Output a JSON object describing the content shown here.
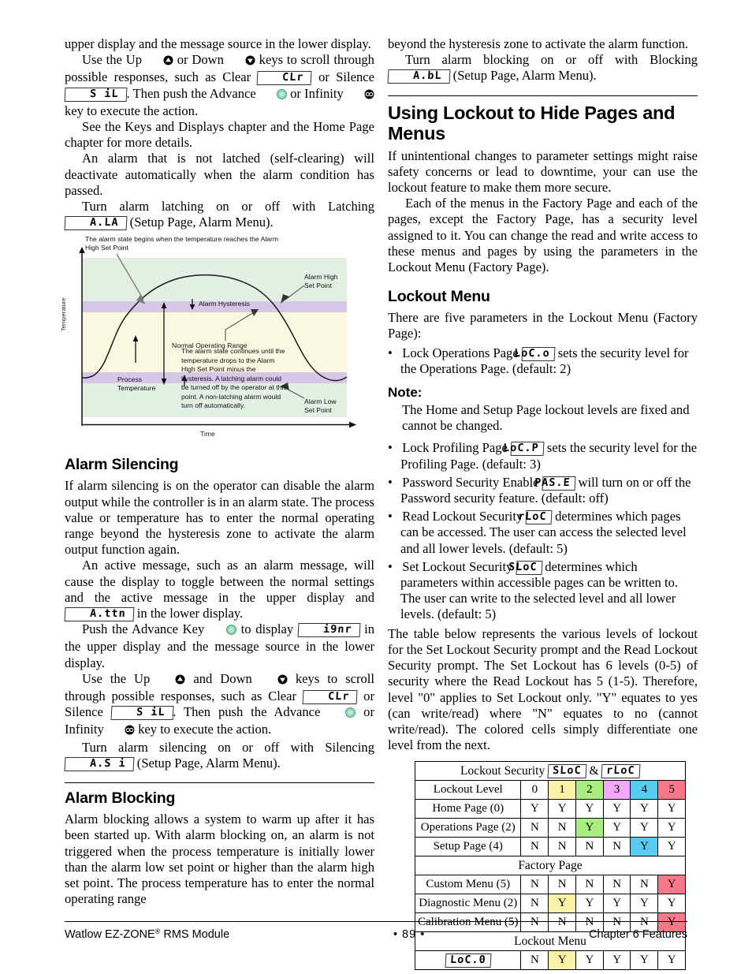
{
  "left_column": {
    "para_1": "upper display and the message source in the lower display.",
    "para_2_a": "Use the Up",
    "para_2_b": "or Down",
    "para_2_c": "keys to scroll through possible responses, such as Clear",
    "para_2_seg_clear": "CLr",
    "para_2_d": "or Silence",
    "para_2_seg_silence": "S iL",
    "para_2_e": ". Then push the Advance",
    "para_2_f": "or Infinity",
    "para_2_g": "key to execute the action.",
    "para_3": "See the Keys and Displays chapter and the Home Page chapter for more details.",
    "para_4": "An alarm that is not latched (self-clearing) will deactivate automatically when the alarm condition has passed.",
    "para_5_a": "Turn alarm latching on or off with Latching",
    "para_5_seg": "A.LA",
    "para_5_b": "(Setup Page, Alarm Menu).",
    "alarm_silencing": {
      "heading": "Alarm Silencing",
      "p1": "If alarm silencing is on the operator can disable the alarm output while the controller is in an alarm state. The process value or temperature has to enter the normal operating range beyond the hysteresis zone to activate the alarm output function again.",
      "p2_a": "An active message, such as an alarm message, will cause the display to toggle between the normal settings and the active message in the upper display and",
      "p2_seg": "A.ttn",
      "p2_b": "in the lower display.",
      "p3_a": "Push the Advance Key",
      "p3_b": "to display",
      "p3_seg": "i9nr",
      "p3_c": "in the upper display and the message source in the lower display.",
      "p4_a": "Use the Up",
      "p4_b": "and Down",
      "p4_c": "keys to scroll through possible responses, such as Clear",
      "p4_seg_clear": "CLr",
      "p4_d": "or Silence",
      "p4_seg_silence": "S iL",
      "p4_e": ". Then push the Advance",
      "p4_f": "or Infinity",
      "p4_g": "key to execute the action.",
      "p5_a": "Turn alarm silencing on or off with Silencing",
      "p5_seg": "A.S i",
      "p5_b": "(Setup Page, Alarm Menu)."
    },
    "alarm_blocking": {
      "heading": "Alarm Blocking",
      "p1": "Alarm blocking allows a system to warm up after it has been started up. With alarm blocking on, an alarm is not triggered when the process temperature is initially lower than the alarm low set point or higher than the alarm high set point. The process temperature has to enter the normal operating range"
    }
  },
  "figure": {
    "callout_top": "The alarm state begins when the temperature reaches the Alarm High Set Point",
    "label_alarm_high": "Alarm High\nSet Point",
    "label_alarm_high_l1": "Alarm High",
    "label_alarm_high_l2": "Set Point",
    "label_alarm_low_l1": "Alarm Low",
    "label_alarm_low_l2": "Set Point",
    "label_hysteresis": "Alarm Hysteresis",
    "label_normal_range": "Normal Operating Range",
    "label_process_temp_l1": "Process",
    "label_process_temp_l2": "Temperature",
    "callout_body": "The alarm state continues until the temperature drops to the Alarm High Set Point minus the hysteresis. A latching alarm could be turned off by the operator at this point. A non-latching alarm would turn off automatically.",
    "axis_y": "Temperature",
    "axis_x": "Time",
    "colors": {
      "alarm_zone": "#e2efe3",
      "hysteresis_band": "#d6c7e8",
      "normal_range": "#fbf8e2"
    }
  },
  "right_column": {
    "para_1": "beyond the hysteresis zone to activate the alarm function.",
    "para_2_a": "Turn alarm blocking on or off with Blocking",
    "para_2_seg": "A.bL",
    "para_2_b": "(Setup Page, Alarm Menu).",
    "major_heading": "Using Lockout to Hide Pages and Menus",
    "para_3": "If unintentional changes to parameter settings might raise safety concerns or lead to downtime, your can use the lockout feature to make them more secure.",
    "para_4": "Each of the menus in the Factory Page and each of the pages, except the Factory Page, has a security level assigned to it. You can change the read and write access to these menus and pages by using the parameters in the Lockout Menu (Factory Page).",
    "lockout_menu": {
      "heading": "Lockout Menu",
      "intro": "There are five parameters in the Lockout Menu (Factory Page):",
      "items": [
        {
          "pre": "Lock Operations Page",
          "seg": "LoC.o",
          "post": "sets the security level for the Operations Page. (default: 2)"
        },
        {
          "pre": "Lock Profiling Page",
          "seg": "LoC.P",
          "post": "sets the security level for the Profiling Page. (default: 3)"
        },
        {
          "pre": "Password Security Enable",
          "seg": "PAS.E",
          "post": "will turn on or off the Password security feature. (default: off)"
        },
        {
          "pre": "Read Lockout Security",
          "seg": "rLoC",
          "post": "determines which pages can be accessed. The user can access the selected level and all lower levels. (default: 5)"
        },
        {
          "pre": "Set Lockout Security",
          "seg": "SLoC",
          "post": "determines which parameters within accessible pages can be written to. The user can write to the selected level and all lower levels. (default: 5)"
        }
      ],
      "note_heading": "Note:",
      "note_body": "The Home and Setup Page lockout levels are fixed and cannot be changed."
    },
    "table_intro": "The table below represents the various levels of lockout for the Set Lockout Security prompt and the Read Lockout Security prompt. The Set Lockout has 6 levels (0-5) of security where the Read Lockout has 5 (1-5). Therefore, level \"0\" applies to Set Lockout only. \"Y\" equates to yes (can write/read) where \"N\" equates to no (cannot write/read). The colored cells simply differentiate one level from the next."
  },
  "table": {
    "title_pre": "Lockout Security",
    "title_seg_1": "SLoC",
    "title_amp": "&",
    "title_seg_2": "rLoC",
    "level_label": "Lockout Level",
    "levels": [
      "0",
      "1",
      "2",
      "3",
      "4",
      "5"
    ],
    "level_colors": [
      "#ffffff",
      "#fbf2a8",
      "#aaee80",
      "#f0a8f8",
      "#55ccf0",
      "#f87888"
    ],
    "rows": [
      {
        "label": "Home Page (0)",
        "values": [
          "Y",
          "Y",
          "Y",
          "Y",
          "Y",
          "Y"
        ],
        "hl": -1
      },
      {
        "label": "Operations Page (2)",
        "values": [
          "N",
          "N",
          "Y",
          "Y",
          "Y",
          "Y"
        ],
        "hl": 2
      },
      {
        "label": "Setup Page (4)",
        "values": [
          "N",
          "N",
          "N",
          "N",
          "Y",
          "Y"
        ],
        "hl": 4
      }
    ],
    "banner_factory": "Factory Page",
    "factory_rows": [
      {
        "label": "Custom Menu (5)",
        "values": [
          "N",
          "N",
          "N",
          "N",
          "N",
          "Y"
        ],
        "hl": 5
      },
      {
        "label": "Diagnostic Menu (2)",
        "values": [
          "N",
          "Y",
          "Y",
          "Y",
          "Y",
          "Y"
        ],
        "hl": 1
      },
      {
        "label": "Calibration Menu (5)",
        "values": [
          "N",
          "N",
          "N",
          "N",
          "N",
          "Y"
        ],
        "hl": 5
      }
    ],
    "banner_lockout": "Lockout Menu",
    "lockout_row": {
      "seg": "LoC.0",
      "values": [
        "N",
        "Y",
        "Y",
        "Y",
        "Y",
        "Y"
      ],
      "hl": 1
    }
  },
  "footer": {
    "left_a": "Watlow EZ-ZONE",
    "left_reg": "®",
    "left_b": " RMS Module",
    "center": "•  89  •",
    "right": "Chapter 6 Features"
  }
}
